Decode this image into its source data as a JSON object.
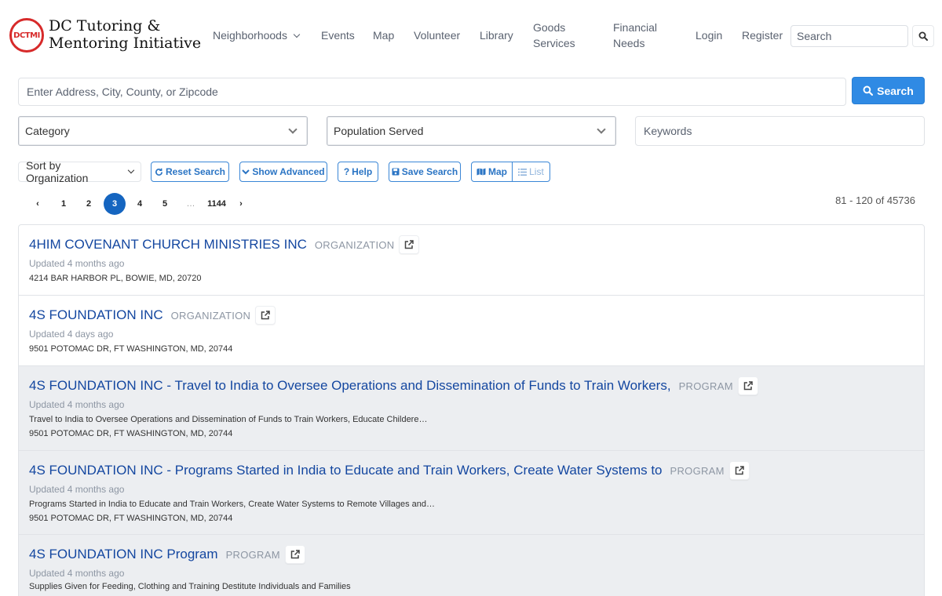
{
  "brand": {
    "logo_text": "DCTMI",
    "line1": "DC Tutoring &",
    "line2": "Mentoring Initiative"
  },
  "nav": {
    "neighborhoods": "Neighborhoods",
    "events": "Events",
    "map": "Map",
    "volunteer": "Volunteer",
    "library": "Library",
    "goods_1": "Goods",
    "goods_2": "Services",
    "financial_1": "Financial",
    "financial_2": "Needs",
    "login": "Login",
    "register": "Register",
    "search_placeholder": "Search"
  },
  "search": {
    "placeholder": "Enter Address, City, County, or Zipcode",
    "button": "Search",
    "category": "Category",
    "population": "Population Served",
    "keywords_placeholder": "Keywords"
  },
  "toolbar": {
    "sort": "Sort by Organization",
    "reset": "Reset Search",
    "advanced": "Show Advanced",
    "help": "Help",
    "save": "Save Search",
    "map": "Map",
    "list": "List"
  },
  "pagination": {
    "prev": "‹",
    "p1": "1",
    "p2": "2",
    "p3": "3",
    "p4": "4",
    "p5": "5",
    "ellipsis": "…",
    "last": "1144",
    "next": "›",
    "active_page": 3,
    "count": "81 - 120 of 45736"
  },
  "results": [
    {
      "title": "4HIM COVENANT CHURCH MINISTRIES INC",
      "type": "ORGANIZATION",
      "updated": "Updated 4 months ago",
      "address": "4214 BAR HARBOR PL, BOWIE, MD, 20720"
    },
    {
      "title": "4S FOUNDATION INC",
      "type": "ORGANIZATION",
      "updated": "Updated 4 days ago",
      "address": "9501 POTOMAC DR, FT WASHINGTON, MD, 20744"
    },
    {
      "title": "4S FOUNDATION INC - Travel to India to Oversee Operations and Dissemination of Funds to Train Workers,",
      "type": "PROGRAM",
      "updated": "Updated 4 months ago",
      "description": "Travel to India to Oversee Operations and Dissemination of Funds to Train Workers, Educate Childere…",
      "address": "9501 POTOMAC DR, FT WASHINGTON, MD, 20744"
    },
    {
      "title": "4S FOUNDATION INC - Programs Started in India to Educate and Train Workers, Create Water Systems to",
      "type": "PROGRAM",
      "updated": "Updated 4 months ago",
      "description": "Programs Started in India to Educate and Train Workers, Create Water Systems to Remote Villages and…",
      "address": "9501 POTOMAC DR, FT WASHINGTON, MD, 20744"
    },
    {
      "title": "4S FOUNDATION INC Program",
      "type": "PROGRAM",
      "updated": "Updated 4 months ago",
      "description": "Supplies Given for Feeding, Clothing and Training Destitute Individuals and Families"
    }
  ],
  "colors": {
    "primary": "#2f8ae4",
    "title_link": "#1447a0",
    "active_page": "#1565c0",
    "logo_red": "#d72a2a"
  },
  "icons": [
    "chevron-down-icon",
    "search-icon",
    "refresh-icon",
    "question-icon",
    "save-icon",
    "map-icon",
    "list-icon",
    "external-link-icon"
  ]
}
